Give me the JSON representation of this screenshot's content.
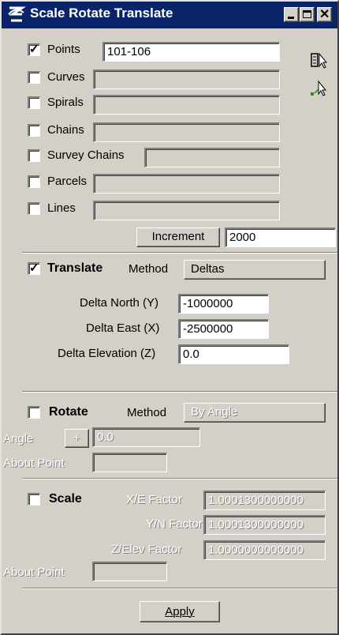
{
  "window": {
    "title": "Scale Rotate Translate"
  },
  "selection": {
    "rows": [
      {
        "label": "Points",
        "checked": true,
        "value": "101-106"
      },
      {
        "label": "Curves",
        "checked": false,
        "value": ""
      },
      {
        "label": "Spirals",
        "checked": false,
        "value": ""
      },
      {
        "label": "Chains",
        "checked": false,
        "value": ""
      },
      {
        "label": "Survey Chains",
        "checked": false,
        "value": ""
      },
      {
        "label": "Parcels",
        "checked": false,
        "value": ""
      },
      {
        "label": "Lines",
        "checked": false,
        "value": ""
      }
    ],
    "increment_label": "Increment",
    "increment_value": "2000"
  },
  "translate": {
    "label": "Translate",
    "checked": true,
    "method_label": "Method",
    "method_value": "Deltas",
    "delta_north_label": "Delta North (Y)",
    "delta_north_value": "-1000000",
    "delta_east_label": "Delta East (X)",
    "delta_east_value": "-2500000",
    "delta_elev_label": "Delta Elevation (Z)",
    "delta_elev_value": "0.0"
  },
  "rotate": {
    "label": "Rotate",
    "checked": false,
    "method_label": "Method",
    "method_value": "By Angle",
    "angle_label": "Angle",
    "angle_sign": "+",
    "angle_value": "0.0",
    "about_point_label": "About Point",
    "about_point_value": ""
  },
  "scale": {
    "label": "Scale",
    "checked": false,
    "xe_label": "X/E Factor",
    "xe_value": "1.0001300000000",
    "yn_label": "Y/N Factor",
    "yn_value": "1.0001300000000",
    "ze_label": "Z/Elev Factor",
    "ze_value": "1.0000000000000",
    "about_point_label": "About Point",
    "about_point_value": ""
  },
  "actions": {
    "apply_label": "Apply"
  }
}
